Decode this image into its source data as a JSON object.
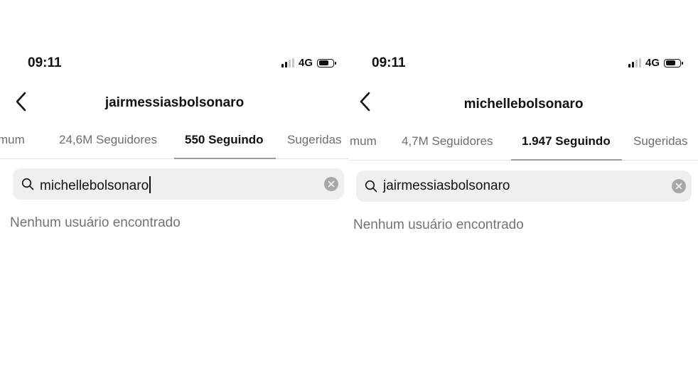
{
  "left": {
    "status": {
      "time": "09:11",
      "network": "4G"
    },
    "header": {
      "title": "jairmessiasbolsonaro"
    },
    "tabs": [
      {
        "label": "mum"
      },
      {
        "label": "24,6M Seguidores"
      },
      {
        "label": "550 Seguindo",
        "active": true
      },
      {
        "label": "Sugeridas"
      }
    ],
    "search": {
      "value": "michellebolsonaro"
    },
    "empty_message": "Nenhum usuário encontrado"
  },
  "right": {
    "status": {
      "time": "09:11",
      "network": "4G"
    },
    "header": {
      "title": "michellebolsonaro"
    },
    "tabs": [
      {
        "label": "mum"
      },
      {
        "label": "4,7M Seguidores"
      },
      {
        "label": "1.947 Seguindo",
        "active": true
      },
      {
        "label": "Sugeridas"
      }
    ],
    "search": {
      "value": "jairmessiasbolsonaro"
    },
    "empty_message": "Nenhum usuário encontrado"
  },
  "icons": {
    "back": "chevron-left-icon",
    "search": "magnifier-icon",
    "clear": "clear-x-icon",
    "signal": "signal-bars-icon",
    "battery": "battery-icon"
  },
  "colors": {
    "background": "#ffffff",
    "search_field": "#efefef",
    "text_primary": "#111111",
    "text_secondary": "#6e6e6e",
    "text_muted": "#737373"
  }
}
